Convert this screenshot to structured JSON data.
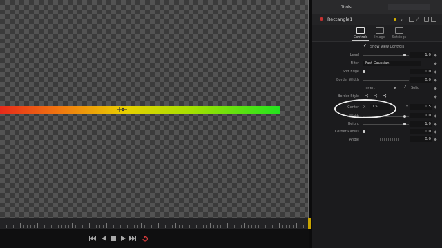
{
  "viewer": {
    "node_shape": "rectangle",
    "gradient_colors": [
      "#e62a1a",
      "#f07a10",
      "#e8d000",
      "#a6e000",
      "#22e21e"
    ]
  },
  "transport": {
    "buttons": [
      "skip-to-start-icon",
      "play-reverse-icon",
      "stop-icon",
      "play-icon",
      "skip-to-end-icon",
      "loop-icon"
    ]
  },
  "inspector": {
    "header_tab": "Tools",
    "tool_name": "Rectangle1",
    "subtabs": [
      "Controls",
      "Image",
      "Settings"
    ],
    "active_subtab": "Controls",
    "show_view_controls": "Show View Controls",
    "params": {
      "level": {
        "label": "Level",
        "value": "1.0"
      },
      "filter": {
        "label": "Filter",
        "value": "Fast Gaussian"
      },
      "soft_edge": {
        "label": "Soft Edge",
        "value": "0.0"
      },
      "border_width": {
        "label": "Border Width",
        "value": "0.0"
      },
      "invert": {
        "label": "Invert"
      },
      "solid": {
        "label": "Solid"
      },
      "border_style": {
        "label": "Border Style"
      },
      "center": {
        "label": "Center",
        "x_label": "X",
        "x_value": "0.5",
        "y_label": "Y",
        "y_value": "0.5"
      },
      "width": {
        "label": "Width",
        "value": "1.0"
      },
      "height": {
        "label": "Height",
        "value": "1.0"
      },
      "corner_radius": {
        "label": "Corner Radius",
        "value": "0.0"
      },
      "angle": {
        "label": "Angle",
        "value": "0.0"
      }
    }
  },
  "annotation": {
    "color": "#f0f0f0"
  }
}
